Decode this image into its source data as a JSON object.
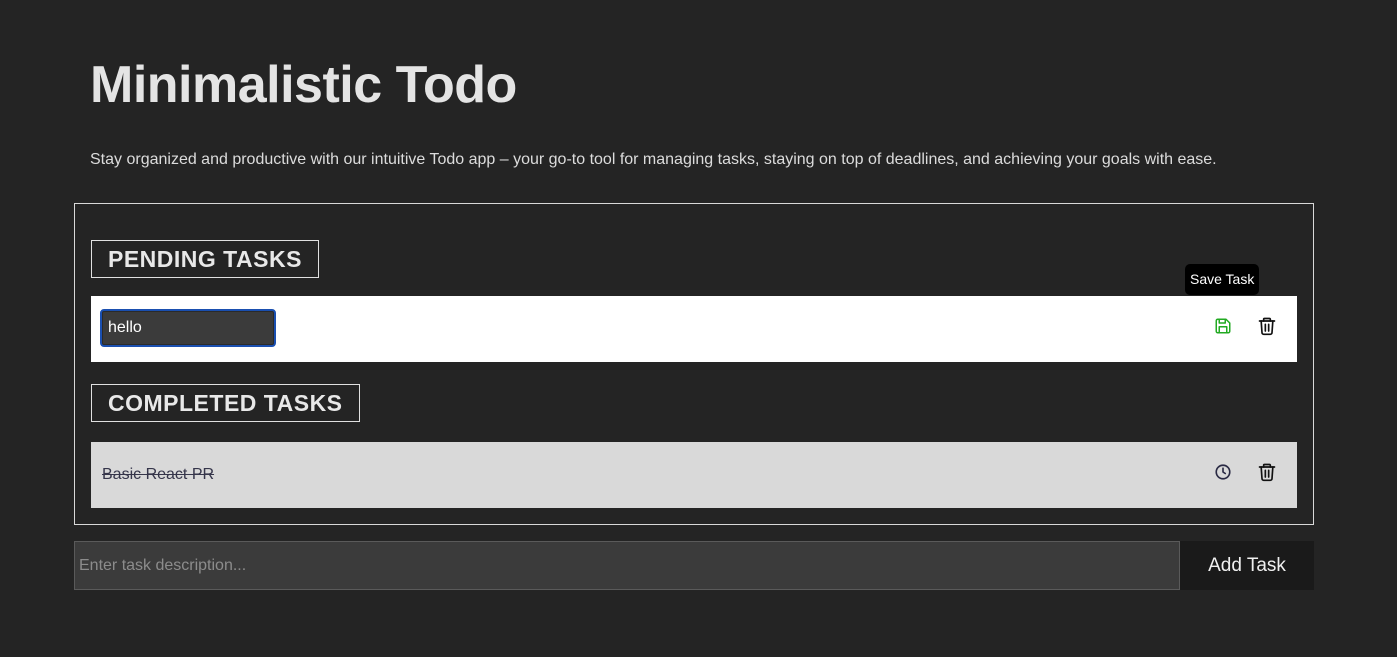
{
  "header": {
    "title": "Minimalistic Todo",
    "subtitle": "Stay organized and productive with our intuitive Todo app – your go-to tool for managing tasks, staying on top of deadlines, and achieving your goals with ease."
  },
  "pending": {
    "heading": "PENDING TASKS",
    "items": [
      {
        "edit_value": "hello",
        "save_icon": "save-icon",
        "delete_icon": "trash-icon",
        "save_color": "#22aa22",
        "tooltip": "Save Task"
      }
    ]
  },
  "completed": {
    "heading": "COMPLETED TASKS",
    "items": [
      {
        "text": "Basic React PR",
        "restore_icon": "clock-icon",
        "delete_icon": "trash-icon"
      }
    ]
  },
  "add_task": {
    "placeholder": "Enter task description...",
    "value": "",
    "button_label": "Add Task"
  },
  "colors": {
    "background": "#242424",
    "pending_row": "#ffffff",
    "completed_row": "#d9d9d9",
    "button_bg": "#1a1a1a"
  }
}
